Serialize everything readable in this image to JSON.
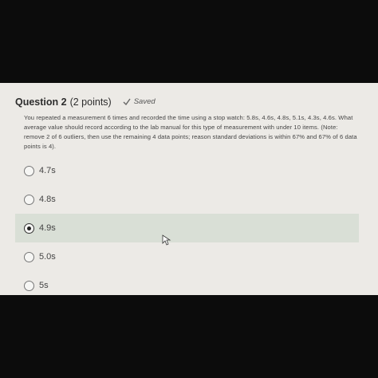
{
  "question": {
    "title": "Question 2",
    "points": "(2 points)",
    "status": "Saved",
    "status_icon": "checkmark-icon",
    "text": "You repeated a measurement 6 times and recorded the time using a stop watch: 5.8s, 4.6s, 4.8s, 5.1s, 4.3s, 4.6s. What average value should record according to the lab manual for this type of measurement with under 10 items. (Note: remove 2 of 6 outliers, then use the remaining 4 data points; reason standard deviations is within 67% and 67% of 6 data points is 4)."
  },
  "options": [
    {
      "label": "4.7s",
      "selected": false
    },
    {
      "label": "4.8s",
      "selected": false
    },
    {
      "label": "4.9s",
      "selected": true
    },
    {
      "label": "5.0s",
      "selected": false
    },
    {
      "label": "5s",
      "selected": false
    }
  ],
  "colors": {
    "background": "#0c0c0c",
    "panel": "#eceae6",
    "selected_row": "#d9dfd6"
  }
}
